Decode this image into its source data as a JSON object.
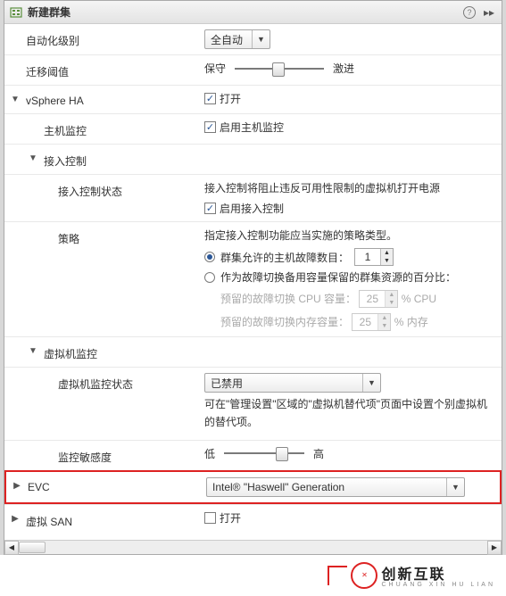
{
  "title": "新建群集",
  "rows": {
    "automation_level": {
      "label": "自动化级别",
      "value": "全自动"
    },
    "migration_threshold": {
      "label": "迁移阈值",
      "left": "保守",
      "right": "激进"
    },
    "vsphere_ha": {
      "label": "vSphere HA",
      "checkbox": "打开",
      "checked": true
    },
    "host_monitoring": {
      "label": "主机监控",
      "checkbox": "启用主机监控",
      "checked": true
    },
    "admission_control": {
      "label": "接入控制"
    },
    "admission_status": {
      "label": "接入控制状态",
      "desc": "接入控制将阻止违反可用性限制的虚拟机打开电源",
      "checkbox": "启用接入控制",
      "checked": true
    },
    "policy": {
      "label": "策略",
      "desc": "指定接入控制功能应当实施的策略类型。",
      "radio1": "群集允许的主机故障数目：",
      "radio1_value": "1",
      "radio2": "作为故障切换备用容量保留的群集资源的百分比：",
      "cpu_reserve": "预留的故障切换 CPU 容量：",
      "cpu_val": "25",
      "cpu_unit": "%  CPU",
      "mem_reserve": "预留的故障切换内存容量：",
      "mem_val": "25",
      "mem_unit": "%  内存"
    },
    "vm_monitoring": {
      "label": "虚拟机监控"
    },
    "vm_monitoring_status": {
      "label": "虚拟机监控状态",
      "value": "已禁用",
      "desc": "可在\"管理设置\"区域的\"虚拟机替代项\"页面中设置个别虚拟机的替代项。"
    },
    "sensitivity": {
      "label": "监控敏感度",
      "left": "低",
      "right": "高"
    },
    "evc": {
      "label": "EVC",
      "value": "Intel® \"Haswell\" Generation"
    },
    "vsan": {
      "label": "虚拟 SAN",
      "checkbox": "打开",
      "checked": false
    }
  },
  "brand": {
    "main": "创新互联",
    "sub": "CHUANG XIN HU LIAN"
  }
}
